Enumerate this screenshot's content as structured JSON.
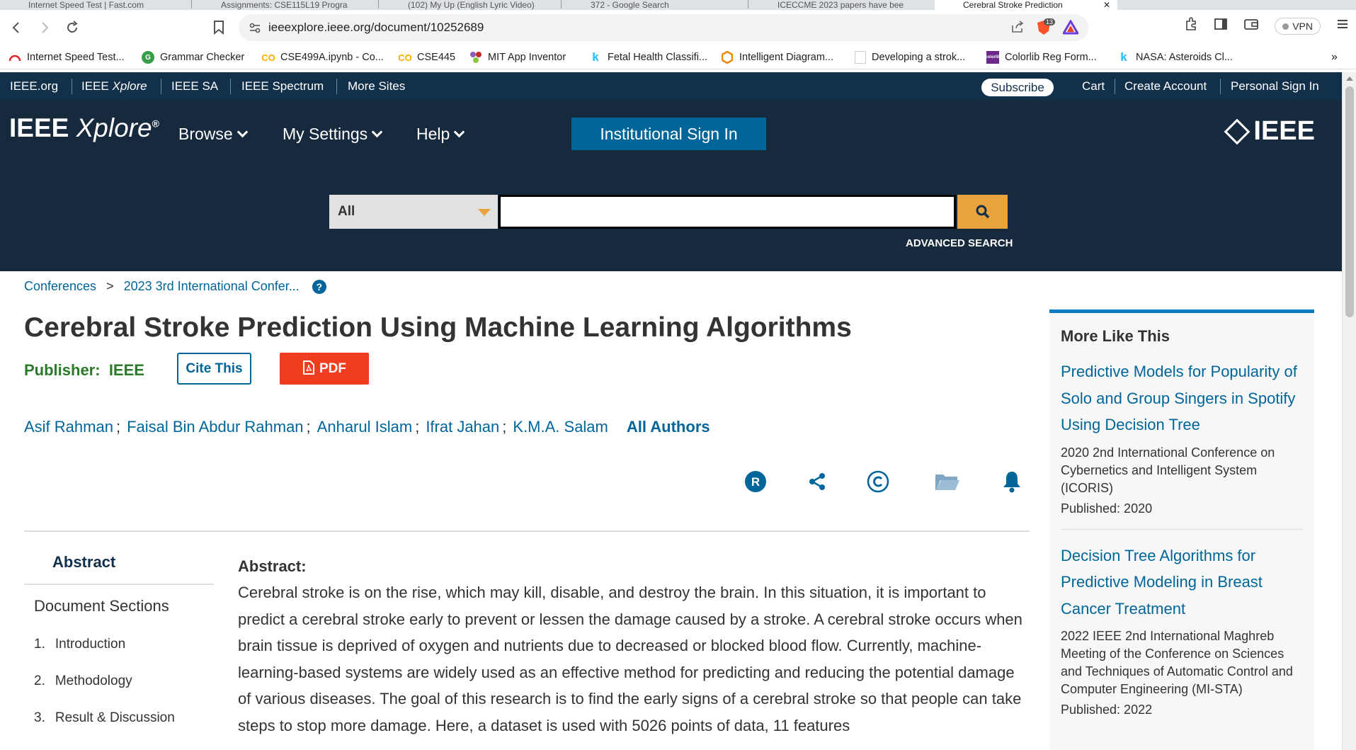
{
  "browser": {
    "tabs": [
      {
        "label": "Internet Speed Test | Fast.com"
      },
      {
        "label": "Assignments: CSE115L19 Progra"
      },
      {
        "label": "(102) My Up (English Lyric Video)"
      },
      {
        "label": "372 - Google Search"
      },
      {
        "label": "ICECCME 2023 papers have bee"
      },
      {
        "label": "Cerebral Stroke Prediction"
      }
    ],
    "url": "ieeexplore.ieee.org/document/10252689",
    "shield_count": "13",
    "vpn_label": "VPN",
    "bookmarks": [
      {
        "label": "Internet Speed Test...",
        "icon": "fast-icon"
      },
      {
        "label": "Grammar Checker",
        "icon": "grammar-icon"
      },
      {
        "label": "CSE499A.ipynb - Co...",
        "icon": "colab-icon"
      },
      {
        "label": "CSE445",
        "icon": "colab-icon"
      },
      {
        "label": "MIT App Inventor",
        "icon": "mit-icon"
      },
      {
        "label": "Fetal Health Classifi...",
        "icon": "kaggle-icon"
      },
      {
        "label": "Intelligent Diagram...",
        "icon": "diagram-icon"
      },
      {
        "label": "Developing a strok...",
        "icon": "doc-icon"
      },
      {
        "label": "Colorlib Reg Form...",
        "icon": "colorlib-icon"
      },
      {
        "label": "NASA: Asteroids Cl...",
        "icon": "kaggle-icon"
      }
    ],
    "more_bookmarks": "»"
  },
  "ieee_top": {
    "links": [
      "IEEE.org",
      "IEEE Xplore",
      "IEEE SA",
      "IEEE Spectrum",
      "More Sites"
    ],
    "subscribe": "Subscribe",
    "cart": "Cart",
    "create_account": "Create Account",
    "sign_in": "Personal Sign In"
  },
  "header": {
    "logo_main": "IEEE",
    "logo_italic": "Xplore",
    "logo_reg": "®",
    "menu": [
      "Browse",
      "My Settings",
      "Help"
    ],
    "inst_sign_in": "Institutional Sign In",
    "ieee_logo": "IEEE",
    "search_scope": "All",
    "search_value": "",
    "advanced_search": "ADVANCED SEARCH"
  },
  "breadcrumb": {
    "items": [
      "Conferences",
      "2023 3rd International Confer..."
    ],
    "separator": ">",
    "help": "?"
  },
  "article": {
    "title": "Cerebral Stroke Prediction Using Machine Learning Algorithms",
    "publisher_label": "Publisher:",
    "publisher": "IEEE",
    "cite": "Cite This",
    "pdf": "PDF",
    "authors": [
      "Asif Rahman",
      "Faisal Bin Abdur Rahman",
      "Anharul Islam",
      "Ifrat Jahan",
      "K.M.A. Salam"
    ],
    "author_sep": ";",
    "all_authors": "All Authors",
    "action_icons": [
      "rights-icon",
      "share-icon",
      "copyright-icon",
      "folder-icon",
      "bell-icon"
    ],
    "abstract_heading": "Abstract:",
    "abstract_text": "Cerebral stroke is on the rise, which may kill, disable, and destroy the brain. In this situation, it is important to predict a cerebral stroke early to prevent or lessen the damage caused by a stroke. A cerebral stroke occurs when brain tissue is deprived of oxygen and nutrients due to decreased or blocked blood flow. Currently, machine-learning-based systems are widely used as an effective method for predicting and reducing the potential damage of various diseases. The goal of this research is to find the early signs of a cerebral stroke so that people can take steps to stop more damage. Here, a dataset is used with 5026 points of data, 11 features"
  },
  "side_nav": {
    "abstract": "Abstract",
    "doc_sections": "Document Sections",
    "items": [
      {
        "num": "1.",
        "label": "Introduction"
      },
      {
        "num": "2.",
        "label": "Methodology"
      },
      {
        "num": "3.",
        "label": "Result & Discussion"
      }
    ]
  },
  "more_like_this": {
    "heading": "More Like This",
    "items": [
      {
        "title": "Predictive Models for Popularity of Solo and Group Singers in Spotify Using Decision Tree",
        "venue": "2020 2nd International Conference on Cybernetics and Intelligent System (ICORIS)",
        "published": "Published: 2020"
      },
      {
        "title": "Decision Tree Algorithms for Predictive Modeling in Breast Cancer Treatment",
        "venue": "2022 IEEE 2nd International Maghreb Meeting of the Conference on Sciences and Techniques of Automatic Control and Computer Engineering (MI-STA)",
        "published": "Published: 2022"
      }
    ]
  },
  "colors": {
    "ieee_dark": "#17293d",
    "ieee_topbar": "#13304a",
    "link_blue": "#006699",
    "publisher_green": "#2b7a29",
    "pdf_red": "#f03c1f",
    "search_orange": "#e8a33d"
  }
}
